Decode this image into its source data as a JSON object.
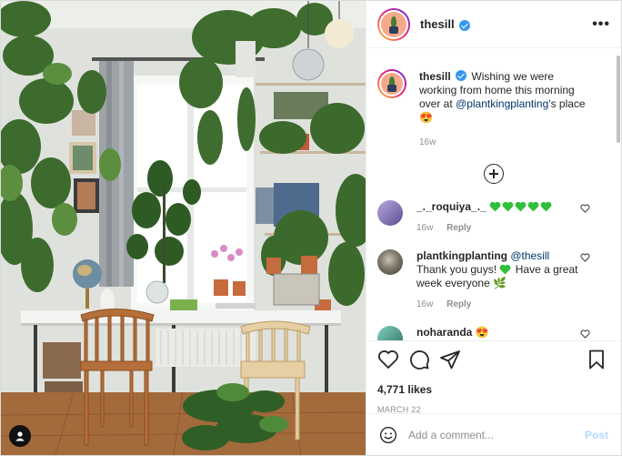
{
  "post": {
    "username": "thesill",
    "verified": true,
    "more_icon": "more-horizontal-icon"
  },
  "caption": {
    "username": "thesill",
    "text_before": "Wishing we were working from home this morning over at ",
    "mention": "@plantkingplanting",
    "text_after": "'s place",
    "emoji": "😍",
    "time": "16w"
  },
  "comments": [
    {
      "username": "_._roquiya_._",
      "text": "",
      "hearts": 5,
      "heart_color": "#2fbf3a",
      "time": "16w",
      "reply_label": "Reply",
      "avatar_color": "#8a6fb8"
    },
    {
      "username": "plantkingplanting",
      "mention": "@thesill",
      "text_line1": "Thank you guys!",
      "text_line2": "Have a great week everyone",
      "emoji_end": "🌿",
      "time": "16w",
      "reply_label": "Reply",
      "avatar_color": "#5c5a4c"
    },
    {
      "username": "noharanda",
      "emoji": "😍",
      "avatar_color": "#3e9a8a"
    }
  ],
  "actions": {
    "likes": "4,771 likes",
    "date": "MARCH 22"
  },
  "add_comment": {
    "placeholder": "Add a comment...",
    "post_label": "Post"
  },
  "colors": {
    "accent_blue": "#3897f0",
    "link": "#00376b",
    "muted": "#8e8e8e",
    "post_disabled": "#b3dbff"
  }
}
